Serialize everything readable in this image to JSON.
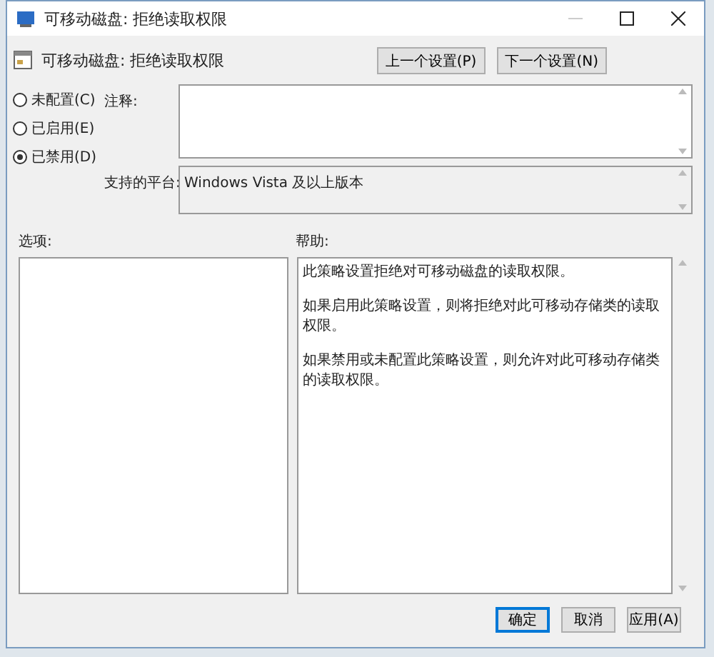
{
  "window": {
    "title": "可移动磁盘: 拒绝读取权限"
  },
  "header": {
    "title": "可移动磁盘: 拒绝读取权限"
  },
  "nav_buttons": [
    "上一个设置(P)",
    "下一个设置(N)"
  ],
  "state_options": [
    {
      "label": "未配置(C)",
      "selected": false
    },
    {
      "label": "已启用(E)",
      "selected": false
    },
    {
      "label": "已禁用(D)",
      "selected": true
    }
  ],
  "comment": {
    "label": "注释:"
  },
  "platform": {
    "label": "支持的平台:",
    "value": "Windows Vista 及以上版本"
  },
  "options": {
    "label": "选项:"
  },
  "help": {
    "label": "帮助:",
    "paragraphs": [
      "此策略设置拒绝对可移动磁盘的读取权限。",
      "如果启用此策略设置，则将拒绝对此可移动存储类的读取权限。",
      "如果禁用或未配置此策略设置，则允许对此可移动存储类的读取权限。"
    ]
  },
  "buttons": [
    {
      "label": "确定",
      "focused": true
    },
    {
      "label": "取消",
      "focused": false
    },
    {
      "label": "应用(A)",
      "focused": false
    }
  ]
}
